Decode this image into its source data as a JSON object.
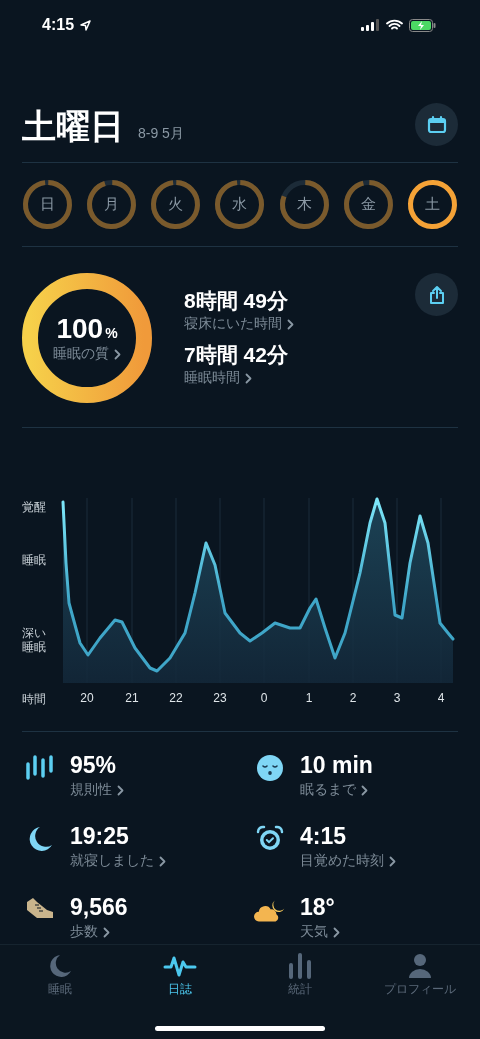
{
  "status_bar": {
    "time": "4:15"
  },
  "header": {
    "title": "土曜日",
    "date_range": "8-9 5月"
  },
  "days": [
    {
      "label": "日",
      "level": 0.97,
      "selected": false
    },
    {
      "label": "月",
      "level": 0.94,
      "selected": false
    },
    {
      "label": "火",
      "level": 0.97,
      "selected": false
    },
    {
      "label": "水",
      "level": 0.97,
      "selected": false
    },
    {
      "label": "木",
      "level": 0.8,
      "selected": false
    },
    {
      "label": "金",
      "level": 0.95,
      "selected": false
    },
    {
      "label": "土",
      "level": 1,
      "selected": true
    }
  ],
  "summary": {
    "quality": {
      "value": "100",
      "unit": "%",
      "label": "睡眠の質",
      "level": 1
    },
    "stats": [
      {
        "value": "8時間 49分",
        "label": "寝床にいた時間"
      },
      {
        "value": "7時間 42分",
        "label": "睡眠時間"
      }
    ]
  },
  "chart": {
    "y_labels": [
      "覚醒",
      "睡眠",
      "深い睡眠"
    ],
    "x_title": "時間",
    "x_labels": [
      "20",
      "21",
      "22",
      "23",
      "0",
      "1",
      "2",
      "3",
      "4"
    ]
  },
  "metrics": [
    {
      "kind": "regularity",
      "value": "95%",
      "label": "規則性"
    },
    {
      "kind": "fall_asleep",
      "value": "10 min",
      "label": "眠るまで"
    },
    {
      "kind": "bedtime",
      "value": "19:25",
      "label": "就寝しました"
    },
    {
      "kind": "wake",
      "value": "4:15",
      "label": "目覚めた時刻"
    },
    {
      "kind": "steps",
      "value": "9,566",
      "label": "歩数"
    },
    {
      "kind": "weather",
      "value": "18°",
      "label": "天気"
    }
  ],
  "tab_bar": [
    {
      "kind": "moon",
      "label": "睡眠",
      "selected": false
    },
    {
      "kind": "wave",
      "label": "日誌",
      "selected": true
    },
    {
      "kind": "bars",
      "label": "統計",
      "selected": false
    },
    {
      "kind": "person",
      "label": "プロフィール",
      "selected": false
    }
  ]
}
